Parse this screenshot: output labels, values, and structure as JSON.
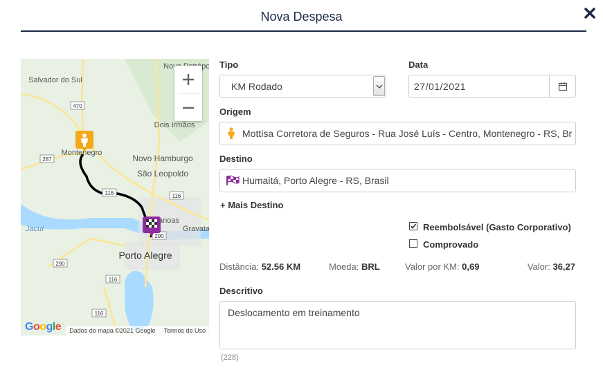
{
  "modal": {
    "title": "Nova Despesa"
  },
  "map": {
    "place_labels": [
      "Salvador do Sul",
      "Nova Petrópolis",
      "Dois Irmãos",
      "Novo Hamburgo",
      "São Leopoldo",
      "Montenegro",
      "Porto Alegre",
      "Gravataí",
      "Canoas",
      "Jacuí"
    ],
    "road_labels": [
      "470",
      "287",
      "116",
      "116",
      "290",
      "290",
      "116",
      "116"
    ],
    "credits": "Dados do mapa ©2021 Google",
    "terms": "Termos de Uso",
    "logo": "Google"
  },
  "form": {
    "tipo": {
      "label": "Tipo",
      "value": "KM Rodado"
    },
    "data": {
      "label": "Data",
      "value": "27/01/2021"
    },
    "origem": {
      "label": "Origem",
      "value": "Mottisa Corretora de Seguros - Rua José Luís - Centro, Montenegro - RS, Br"
    },
    "destino": {
      "label": "Destino",
      "value": "Humaitá, Porto Alegre - RS, Brasil"
    },
    "mais_destino": "+ Mais Destino",
    "reembolsavel": {
      "label": "Reembolsável (Gasto Corporativo)",
      "checked": true
    },
    "comprovado": {
      "label": "Comprovado",
      "checked": false
    },
    "distancia": {
      "label": "Distância:",
      "value": "52.56 KM"
    },
    "moeda": {
      "label": "Moeda:",
      "value": "BRL"
    },
    "valor_km": {
      "label": "Valor por KM:",
      "value": "0,69"
    },
    "valor": {
      "label": "Valor:",
      "value": "36,27"
    },
    "descritivo": {
      "label": "Descritivo",
      "value": "Deslocamento em treinamento",
      "counter": "(228)"
    }
  },
  "colors": {
    "title": "#1c2a47",
    "origin_marker": "#f4a91a",
    "destination_marker": "#8e2b9e",
    "route": "#000000"
  }
}
